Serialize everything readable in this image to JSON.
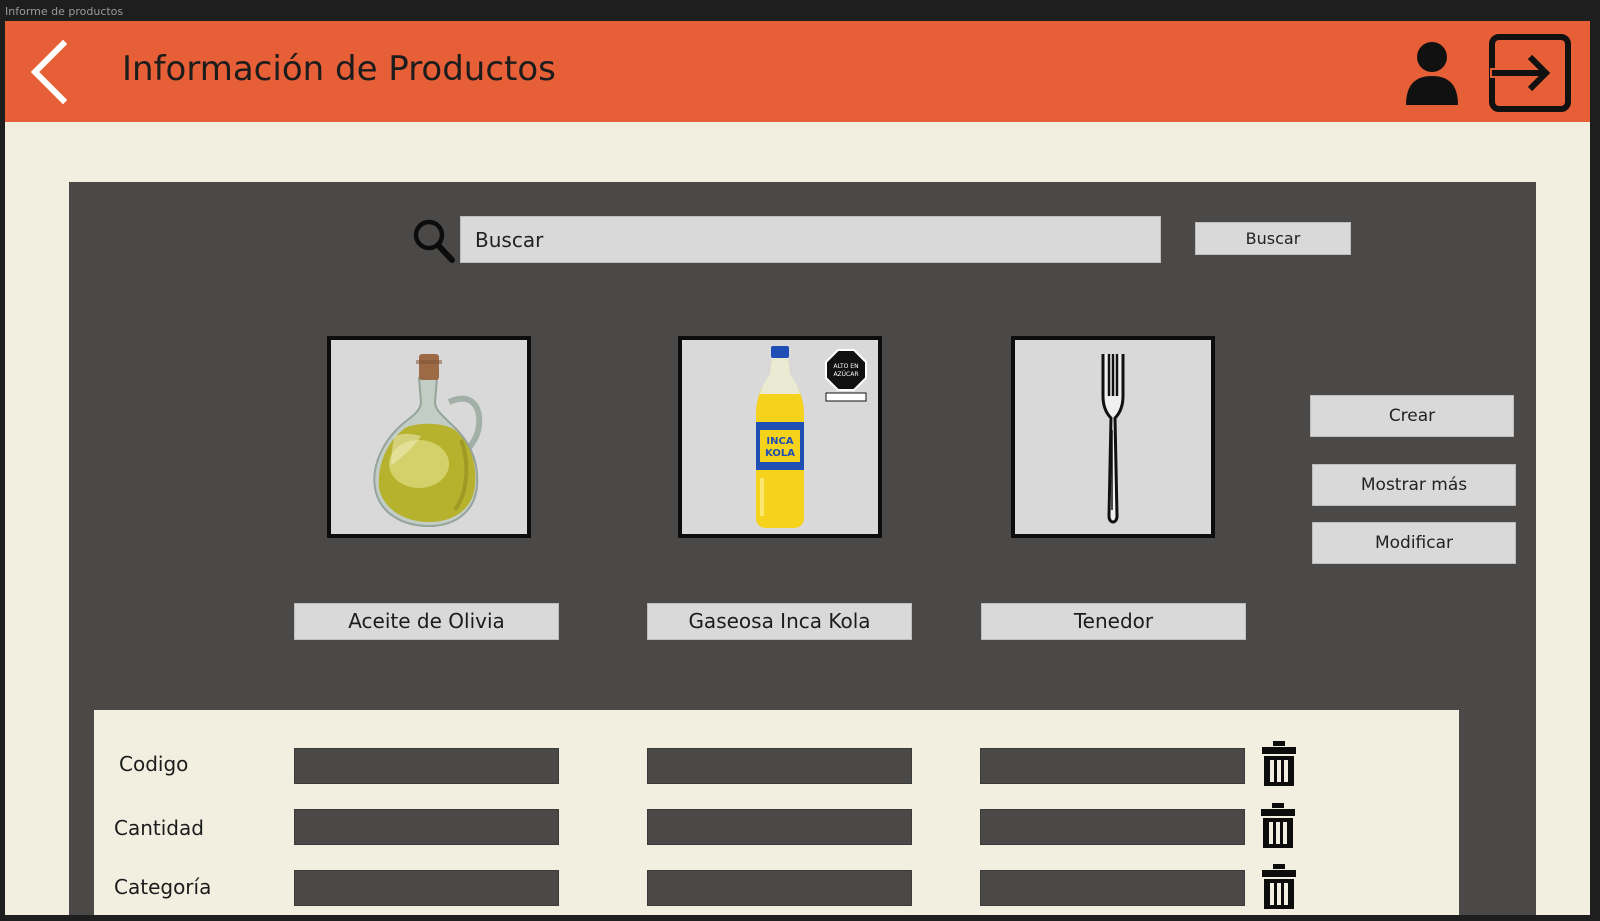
{
  "window": {
    "title": "Informe de productos"
  },
  "header": {
    "title": "Información de Productos",
    "back_icon": "chevron-left-icon",
    "user_icon": "user-icon",
    "logout_icon": "logout-icon",
    "accent_color": "#e65f36"
  },
  "search": {
    "placeholder": "Buscar",
    "button_label": "Buscar",
    "icon": "search-icon"
  },
  "products": [
    {
      "name": "Aceite de Olivia",
      "image": "olive-oil-bottle"
    },
    {
      "name": "Gaseosa Inca Kola",
      "image": "inca-kola-bottle",
      "bottle_logo": "INCA KOLA",
      "badge_text": "ALTO EN AZÚCAR"
    },
    {
      "name": "Tenedor",
      "image": "fork"
    }
  ],
  "actions": {
    "create": "Crear",
    "show_more": "Mostrar más",
    "modify": "Modificar"
  },
  "details": {
    "rows": [
      {
        "label": "Codigo"
      },
      {
        "label": "Cantidad"
      },
      {
        "label": "Categoría"
      }
    ],
    "delete_icon": "trash-icon"
  },
  "colors": {
    "background": "#f2efe0",
    "panel": "#4a4948",
    "field": "#d9d9d9"
  }
}
